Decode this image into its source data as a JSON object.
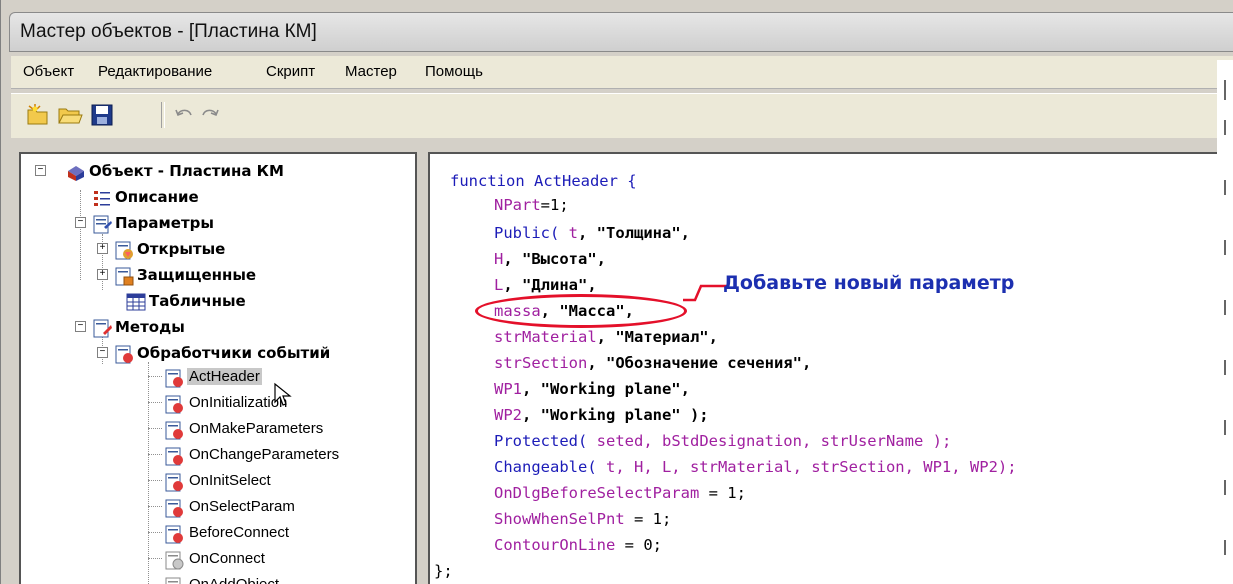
{
  "window": {
    "title": "Мастер объектов - [Пластина КМ]"
  },
  "menu": {
    "items": [
      "Объект",
      "Редактирование",
      "Скрипт",
      "Мастер",
      "Помощь"
    ]
  },
  "toolbar": {
    "buttons": [
      "new-object-icon",
      "open-folder-icon",
      "save-icon",
      "undo-icon",
      "redo-icon"
    ]
  },
  "tree": {
    "root": "Объект - Пластина КМ",
    "description": "Описание",
    "parameters": "Параметры",
    "open": "Открытые",
    "protected": "Защищенные",
    "tabular": "Табличные",
    "methods": "Методы",
    "event_handlers": "Обработчики событий",
    "handlers": [
      "ActHeader",
      "OnInitialization",
      "OnMakeParameters",
      "OnChangeParameters",
      "OnInitSelect",
      "OnSelectParam",
      "BeforeConnect",
      "OnConnect",
      "OnAddObject"
    ],
    "selected": "ActHeader"
  },
  "code": {
    "line_1_kw": "function",
    "line_1_rest": " ActHeader {",
    "line_2_var": "NPart",
    "line_2_rest": "=1;",
    "line_3_kw": "Public(",
    "line_3_var": " t",
    "line_3_str": ", \"Толщина\",",
    "line_4_var": "H",
    "line_4_str": ", \"Высота\",",
    "line_5_var": "L",
    "line_5_str": ", \"Длина\",",
    "line_6_var": "massa",
    "line_6_str": ", \"Масса\",",
    "line_7_var": "strMaterial",
    "line_7_str": ", \"Материал\",",
    "line_8_var": "strSection",
    "line_8_str": ", \"Обозначение сечения\",",
    "line_9_var": "WP1",
    "line_9_str": ", \"Working plane\",",
    "line_10_var": "WP2",
    "line_10_str": ", \"Working plane\" );",
    "line_11_kw": "Protected(",
    "line_11_var": " seted",
    "line_11_rest": ", bStdDesignation, strUserName );",
    "line_12_kw": "Changeable(",
    "line_12_rest": " t, H, L, strMaterial, strSection, WP1, WP2);",
    "line_13_var": "OnDlgBeforeSelectParam",
    "line_13_rest": " = 1;",
    "line_14_var": "ShowWhenSelPnt",
    "line_14_rest": " = 1;",
    "line_15_var": "ContourOnLine",
    "line_15_rest": " = 0;",
    "line_16": "};"
  },
  "annotation": {
    "text": "Добавьте новый параметр",
    "color": "#1c2fb0",
    "highlight_color": "#e4102a"
  }
}
